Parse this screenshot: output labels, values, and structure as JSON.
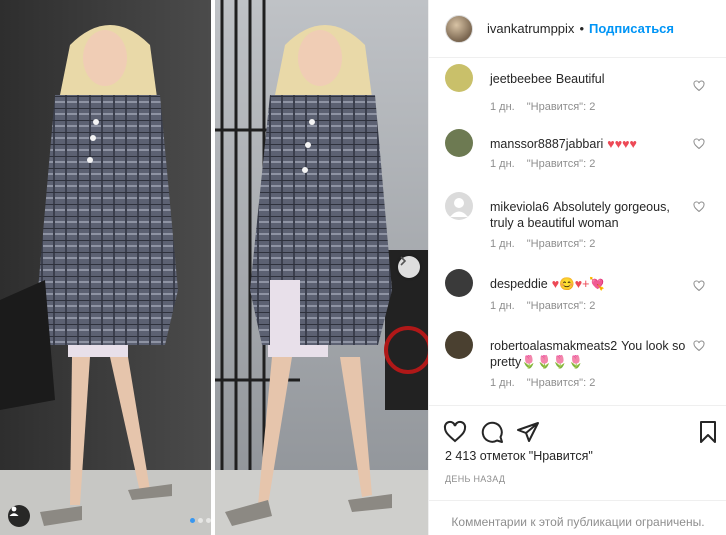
{
  "colors": {
    "accent": "#0095f6",
    "heart": "#ed4956",
    "muted": "#8e8e8e",
    "text": "#262626"
  },
  "post": {
    "image_alt": "photo of a woman in a grey plaid coat walking",
    "carousel": {
      "total": 3,
      "active": 1
    }
  },
  "header": {
    "username": "ivankatrumppix",
    "separator": "•",
    "follow_label": "Подписаться"
  },
  "comments": [
    {
      "username": "jeetbeebee",
      "text": "Beautiful",
      "time": "1 дн.",
      "likes": "\"Нравится\": 2",
      "avatar_color": "#c9c06a"
    },
    {
      "username": "manssor8887jabbari",
      "text": "♥♥♥♥",
      "time": "1 дн.",
      "likes": "\"Нравится\": 2",
      "avatar_color": "#6d7a52"
    },
    {
      "username": "mikeviola6",
      "text": "Absolutely gorgeous, truly a beautiful woman",
      "time": "1 дн.",
      "likes": "\"Нравится\": 2",
      "avatar_color": "#dbdbdb"
    },
    {
      "username": "despeddie",
      "text": "♥😊♥+💘",
      "time": "1 дн.",
      "likes": "\"Нравится\": 2",
      "avatar_color": "#3a3a3a"
    },
    {
      "username": "robertoalasmakmeats2",
      "text": "You look so pretty🌷🌷🌷🌷",
      "time": "1 дн.",
      "likes": "\"Нравится\": 2",
      "avatar_color": "#4a4030"
    }
  ],
  "actions": {
    "icons": [
      "heart-icon",
      "comment-icon",
      "share-icon",
      "bookmark-icon"
    ],
    "likes_count": "2 413 отметок \"Нравится\"",
    "date": "ДЕНЬ НАЗАД",
    "comments_closed": "Комментарии к этой публикации ограничены."
  }
}
